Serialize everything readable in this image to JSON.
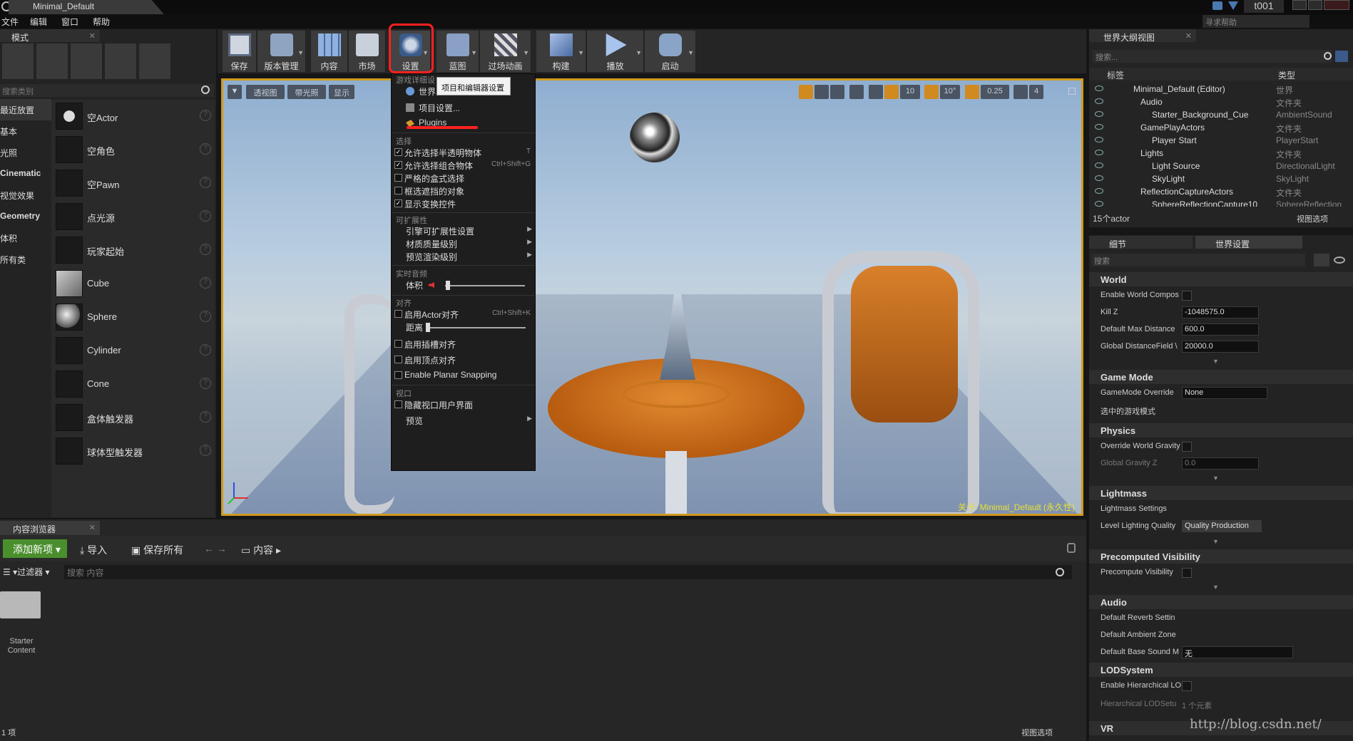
{
  "window": {
    "title": "Minimal_Default",
    "username": "t001",
    "help_search_placeholder": "寻求帮助"
  },
  "menu": [
    "文件",
    "编辑",
    "窗口",
    "帮助"
  ],
  "modes": {
    "tab": "模式",
    "search_placeholder": "搜索类别",
    "categories": [
      "最近放置",
      "基本",
      "光照",
      "Cinematic",
      "视觉效果",
      "Geometry",
      "体积",
      "所有类"
    ],
    "items": [
      "空Actor",
      "空角色",
      "空Pawn",
      "点光源",
      "玩家起始",
      "Cube",
      "Sphere",
      "Cylinder",
      "Cone",
      "盒体触发器",
      "球体型触发器"
    ]
  },
  "toolbar": [
    {
      "label": "保存",
      "icon": "save-icon"
    },
    {
      "label": "版本管理",
      "icon": "source-control-icon"
    },
    {
      "label": "内容",
      "icon": "content-icon"
    },
    {
      "label": "市场",
      "icon": "marketplace-icon"
    },
    {
      "label": "设置",
      "icon": "settings-icon"
    },
    {
      "label": "蓝图",
      "icon": "blueprint-icon"
    },
    {
      "label": "过场动画",
      "icon": "cinematics-icon"
    },
    {
      "label": "构建",
      "icon": "build-icon"
    },
    {
      "label": "播放",
      "icon": "play-icon"
    },
    {
      "label": "启动",
      "icon": "launch-icon"
    }
  ],
  "viewport": {
    "buttons": [
      "透视图",
      "带光照",
      "显示"
    ],
    "grid_snap": "10",
    "rot_snap": "10°",
    "scale_snap": "0.25",
    "camera_speed": "4",
    "actor_label": "关卡: Minimal_Default (永久性)"
  },
  "settings_menu": {
    "section_game": "游戏详细设",
    "world_item": "世界",
    "tooltip": "项目和编辑器设置",
    "project_settings": "项目设置...",
    "plugins": "Plugins",
    "section_select": "选择",
    "select_items": [
      {
        "label": "允许选择半透明物体",
        "shortcut": "T",
        "checked": "✓"
      },
      {
        "label": "允许选择组合物体",
        "shortcut": "Ctrl+Shift+G",
        "checked": "✓"
      },
      {
        "label": "严格的盒式选择",
        "shortcut": "",
        "checked": ""
      },
      {
        "label": "框选遮挡的对象",
        "shortcut": "",
        "checked": ""
      },
      {
        "label": "显示变换控件",
        "shortcut": "",
        "checked": "✓"
      }
    ],
    "section_ext": "可扩展性",
    "ext_items": [
      "引擎可扩展性设置",
      "材质质量级别",
      "预览渲染级别"
    ],
    "section_audio": "实时音频",
    "volume": "体积",
    "section_snap": "对齐",
    "snap_actor": "启用Actor对齐",
    "snap_actor_shortcut": "Ctrl+Shift+K",
    "snap_distance": "距离",
    "snap_socket": "启用插槽对齐",
    "snap_vertex": "启用顶点对齐",
    "snap_planar": "Enable Planar Snapping",
    "section_view": "视口",
    "hide_ui": "隐藏视口用户界面",
    "preview": "预览"
  },
  "outliner": {
    "tab": "世界大纲视图",
    "search_placeholder": "搜索...",
    "col_label": "标签",
    "col_type": "类型",
    "rows": [
      {
        "name": "Minimal_Default (Editor)",
        "type": "世界"
      },
      {
        "name": "Audio",
        "type": "文件夹"
      },
      {
        "name": "Starter_Background_Cue",
        "type": "AmbientSound"
      },
      {
        "name": "GamePlayActors",
        "type": "文件夹"
      },
      {
        "name": "Player Start",
        "type": "PlayerStart"
      },
      {
        "name": "Lights",
        "type": "文件夹"
      },
      {
        "name": "Light Source",
        "type": "DirectionalLight"
      },
      {
        "name": "SkyLight",
        "type": "SkyLight"
      },
      {
        "name": "ReflectionCaptureActors",
        "type": "文件夹"
      },
      {
        "name": "SphereReflectionCapture10",
        "type": "SphereReflection"
      }
    ],
    "count": "15个actor",
    "view_options": "视图选项"
  },
  "details": {
    "tab_details": "细节",
    "tab_world": "世界设置",
    "search_placeholder": "搜索",
    "sections": {
      "world": "World",
      "game_mode": "Game Mode",
      "physics": "Physics",
      "lightmass": "Lightmass",
      "precomputed": "Precomputed Visibility",
      "audio": "Audio",
      "lod": "LODSystem",
      "vr": "VR"
    },
    "enable_world_comp": "Enable World Compos",
    "kill_z": "Kill Z",
    "kill_z_val": "-1048575.0",
    "max_dist": "Default Max Distance",
    "max_dist_val": "600.0",
    "gdf": "Global DistanceField \\",
    "gdf_val": "20000.0",
    "gm_override": "GameMode Override",
    "gm_override_val": "None",
    "selected_gm": "选中的游戏模式",
    "override_gravity": "Override World Gravity",
    "global_gravity": "Global Gravity Z",
    "global_gravity_val": "0.0",
    "lightmass_settings": "Lightmass Settings",
    "level_quality": "Level Lighting Quality",
    "level_quality_val": "Quality Production",
    "precompute": "Precompute Visibility",
    "reverb": "Default Reverb Settin",
    "ambient_zone": "Default Ambient Zone",
    "base_sound": "Default Base Sound M",
    "base_sound_val": "无",
    "enable_hlod": "Enable Hierarchical LO",
    "hlod_setup": "Hierarchical LODSetu",
    "hlod_count": "1 个元素"
  },
  "content_browser": {
    "tab": "内容浏览器",
    "add_new": "添加新项",
    "import": "导入",
    "save_all": "保存所有",
    "path": "内容",
    "filter": "过滤器",
    "search_placeholder": "搜索 内容",
    "folder": "Starter Content",
    "count": "1 项",
    "view_options": "视图选项"
  },
  "watermark": "http://blog.csdn.net/"
}
